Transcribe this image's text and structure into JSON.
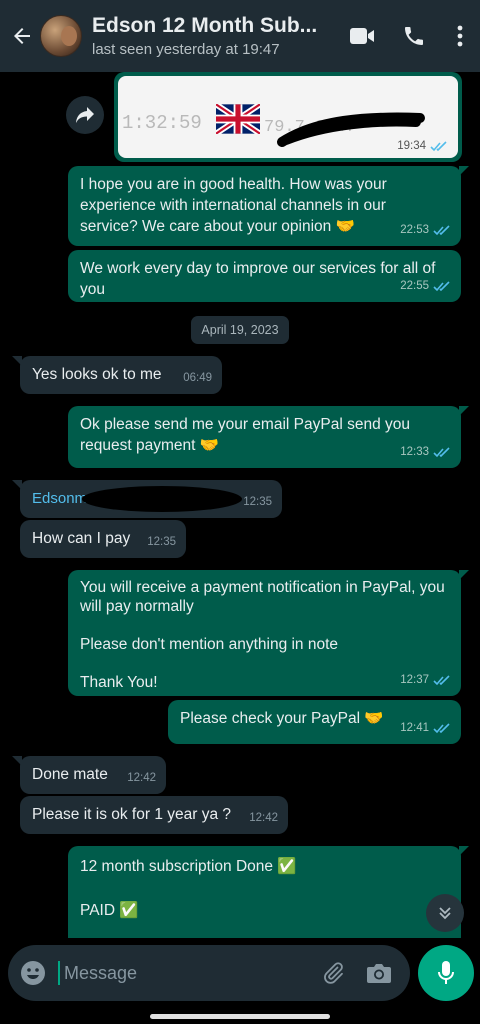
{
  "header": {
    "title": "Edson 12 Month Sub...",
    "subtitle": "last seen yesterday at 19:47",
    "icons": [
      "back-arrow-icon",
      "avatar",
      "video-call-icon",
      "phone-icon",
      "more-vert-icon"
    ]
  },
  "image_message": {
    "left_text": "1:32:59",
    "right_text": "79.7    3.47",
    "time": "19:34"
  },
  "messages": [
    {
      "id": "m1",
      "dir": "out",
      "text": "I hope you are in good health.  How was your experience with international channels in our service? We care about your opinion 🤝",
      "time": "22:53"
    },
    {
      "id": "m2",
      "dir": "out",
      "text": "We work every day to improve our services for all of you",
      "time": "22:55"
    },
    {
      "id": "m3",
      "dir": "in",
      "text": "Yes looks ok to me",
      "time": "06:49"
    },
    {
      "id": "m4",
      "dir": "out",
      "text": "Ok please send me your email PayPal send you request payment 🤝",
      "time": "12:33"
    },
    {
      "id": "m5",
      "dir": "in",
      "sender": "Edsonm",
      "text": "",
      "time": "12:35"
    },
    {
      "id": "m6",
      "dir": "in",
      "text": "How can I pay",
      "time": "12:35"
    },
    {
      "id": "m7",
      "dir": "out",
      "text": "You will receive a payment notification in PayPal, you will pay normally\n\nPlease don't mention anything in note\n\nThank You!",
      "time": "12:37"
    },
    {
      "id": "m8",
      "dir": "out",
      "text": "Please check your PayPal 🤝",
      "time": "12:41"
    },
    {
      "id": "m9",
      "dir": "in",
      "text": "Done mate",
      "time": "12:42"
    },
    {
      "id": "m10",
      "dir": "in",
      "text": "Please it is ok for 1 year ya ?",
      "time": "12:42"
    },
    {
      "id": "m11",
      "dir": "out",
      "text": "12 month subscription Done ✅\n\nPAID ✅",
      "time": ""
    }
  ],
  "date_divider": "April 19, 2023",
  "composer": {
    "placeholder": "Message",
    "value": ""
  },
  "colors": {
    "outgoing_bubble": "#005c4b",
    "incoming_bubble": "#1f2c34",
    "accent": "#00a884",
    "read_ticks": "#53bdeb"
  }
}
